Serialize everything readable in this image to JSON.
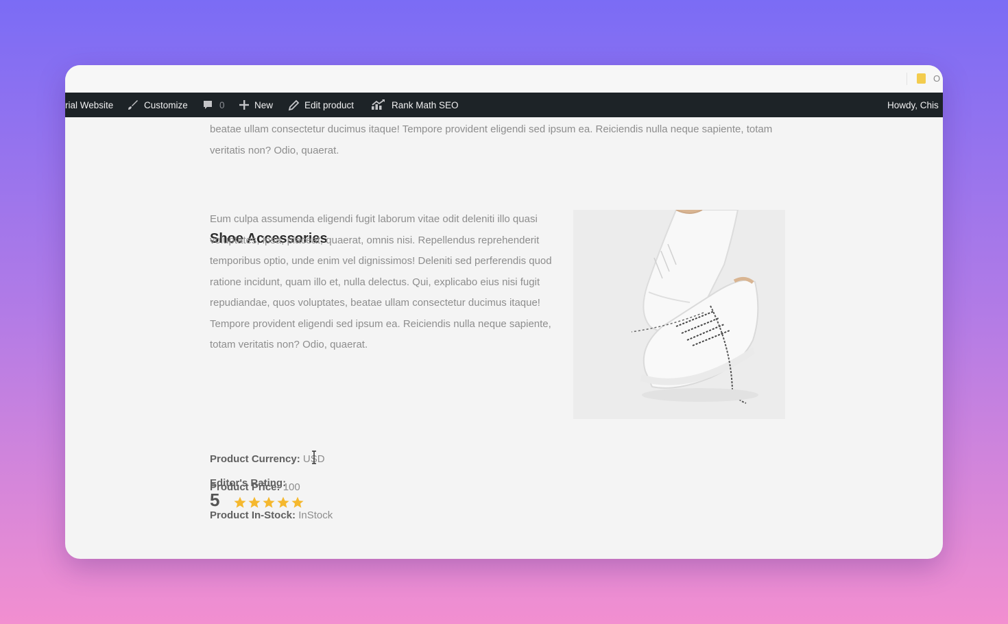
{
  "browser": {
    "bookmark_label": "O"
  },
  "adminbar": {
    "site_name": "rial Website",
    "customize": "Customize",
    "comments_count": "0",
    "new": "New",
    "edit_product": "Edit product",
    "rank_math": "Rank Math SEO",
    "howdy": "Howdy, Chis"
  },
  "content": {
    "intro_text": "beatae ullam consectetur ducimus itaque! Tempore provident eligendi sed ipsum ea. Reiciendis nulla neque sapiente, totam veritatis non? Odio, quaerat.",
    "section_title": "Shoe Accessories",
    "body_text": "Eum culpa assumenda eligendi fugit laborum vitae odit deleniti illo quasi voluptates, ipsa, placeat, quaerat, omnis nisi. Repellendus reprehenderit temporibus optio, unde enim vel dignissimos! Deleniti sed perferendis quod ratione incidunt, quam illo et, nulla delectus. Qui, explicabo eius nisi fugit repudiandae, quos voluptates, beatae ullam consectetur ducimus itaque! Tempore provident eligendi sed ipsum ea. Reiciendis nulla neque sapiente, totam veritatis non? Odio, quaerat.",
    "currency_label": "Product Currency:",
    "currency_value": "USD",
    "price_label": "Product Price:",
    "price_value": "100",
    "stock_label": "Product In-Stock:",
    "stock_value": "InStock",
    "rating_label": "Editor's Rating:",
    "rating_value": "5",
    "rating_stars": 5
  },
  "colors": {
    "adminbar_bg": "#1d2327",
    "star": "#f5b82e",
    "bookmark": "#f3cc4e"
  },
  "icons": [
    "brush-icon",
    "comment-icon",
    "plus-icon",
    "pencil-icon",
    "rank-math-icon",
    "bookmark-icon",
    "star-icon",
    "text-cursor-icon"
  ]
}
